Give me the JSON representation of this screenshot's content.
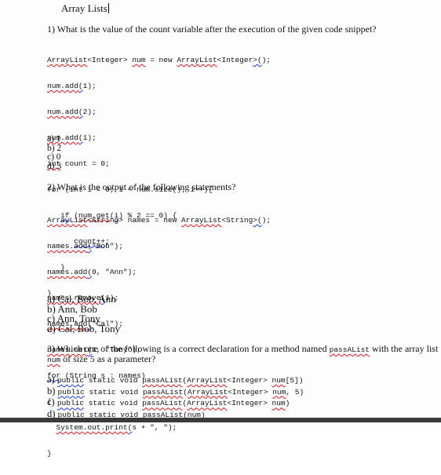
{
  "document": {
    "title": "Array Lists",
    "questions": [
      {
        "prompt": "1) What is the value of the count variable after the execution of the given code snippet?",
        "code": [
          "ArrayList<Integer> num = new ArrayList<Integer>();",
          "num.add(1);",
          "num.add(2);",
          "num.add(1);",
          "int count = 0;",
          "for (int i = 0; i < num.size(); i++){",
          "   if (num.get(i) % 2 == 0) {",
          "      count++;",
          "   }",
          "}"
        ],
        "options": [
          "a) 1",
          "b) 2",
          "c) 0",
          "d) 3"
        ]
      },
      {
        "prompt": "2) What is the output of the following statements?",
        "code": [
          "ArrayList<String> names = new ArrayList<String>();",
          "names.add(\"Bob\");",
          "names.add(0, \"Ann\");",
          "names.remove(1);",
          "names.add(\"Cal\");",
          "names.set(1, \"Tony\");",
          "for (String s : names)",
          "{",
          "  System.out.print(s + \", \");",
          "}"
        ],
        "options": [
          "a) Cal, Bob, Ann",
          "b) Ann, Bob",
          "c) Ann, Tony",
          "d) Cal, Bob, Tony"
        ]
      },
      {
        "prompt_part1": "3) Which one of the following is a correct declaration for a method named ",
        "prompt_code1": "passAList",
        "prompt_part2": " with the array list",
        "prompt_code2": "num",
        "prompt_part3": " of size 5 as a parameter?",
        "options": [
          {
            "label": "a)",
            "code": "public static void passAList(ArrayList<Integer> num[5])"
          },
          {
            "label": "b)",
            "code": "public static void passAList(ArrayList<Integer> num, 5)"
          },
          {
            "label": "c)",
            "code": "public static void passAList(ArrayList<Integer> num)"
          },
          {
            "label": "d)",
            "code": "public static void passAList(num)"
          }
        ]
      }
    ]
  }
}
